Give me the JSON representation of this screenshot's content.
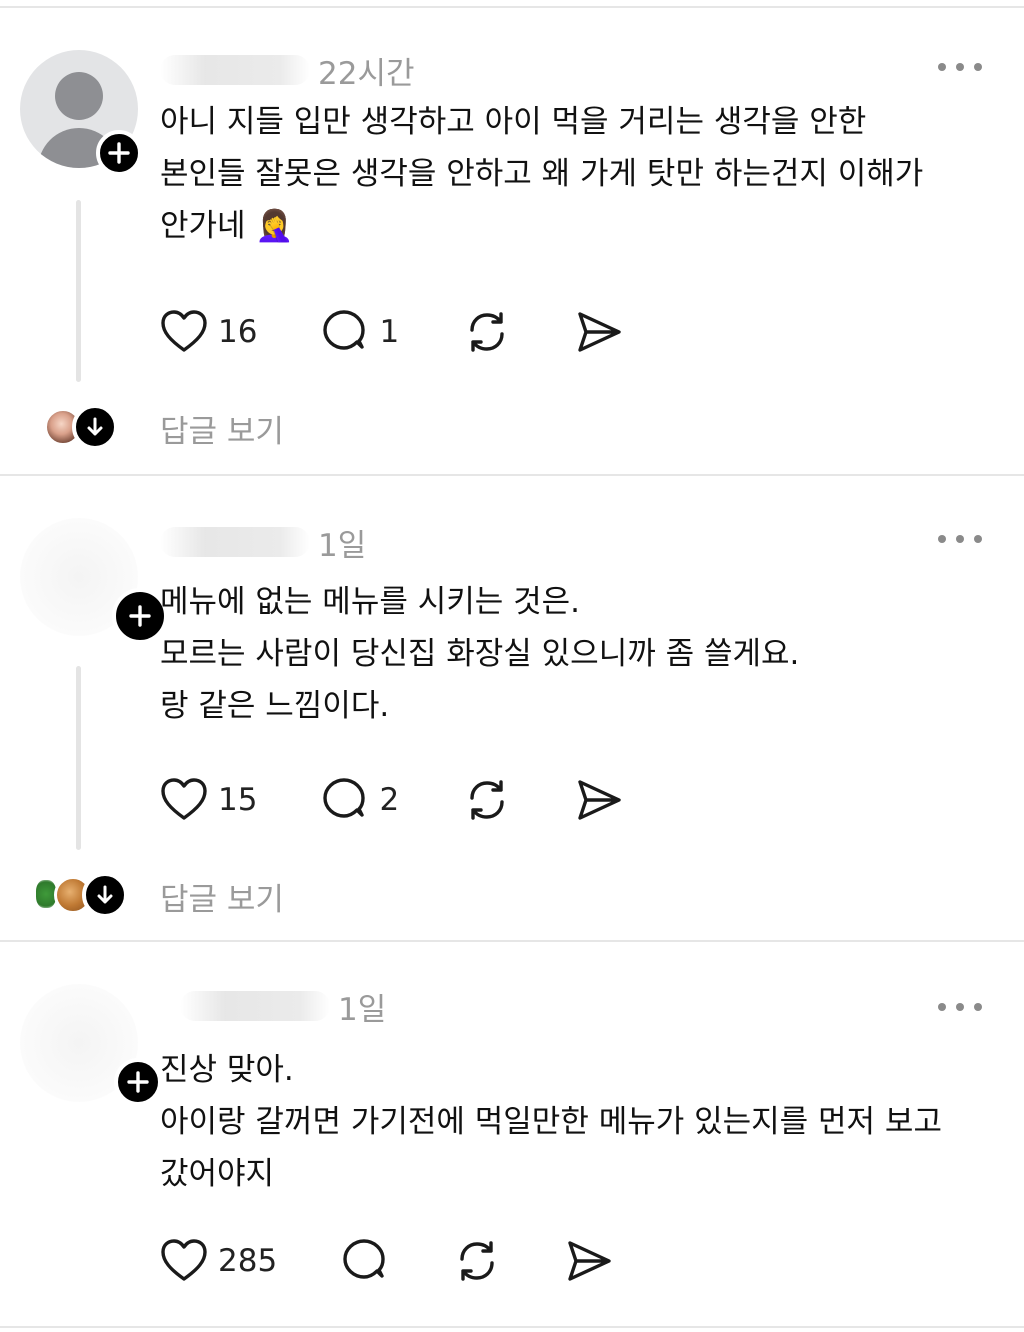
{
  "posts": [
    {
      "time": "22시간",
      "lines": [
        "아니 지들 입만 생각하고 아이 먹을 거리는 생각을 안한",
        "본인들 잘못은 생각을 안하고 왜 가게 탓만 하는건지 이해가",
        "안가네 🤦‍♀️"
      ],
      "likes": "16",
      "comments": "1",
      "view_replies": "답글 보기"
    },
    {
      "time": "1일",
      "lines": [
        "메뉴에 없는 메뉴를 시키는 것은.",
        "모르는 사람이 당신집 화장실 있으니까 좀 쓸게요.",
        "랑 같은 느낌이다."
      ],
      "likes": "15",
      "comments": "2",
      "view_replies": "답글 보기"
    },
    {
      "time": "1일",
      "lines": [
        "진상 맞아.",
        "아이랑 갈꺼면 가기전에 먹일만한 메뉴가 있는지를 먼저 보고",
        "갔어야지"
      ],
      "likes": "285"
    }
  ],
  "icons": {
    "like": "heart-icon",
    "comment": "comment-bubble-icon",
    "repost": "repost-icon",
    "share": "send-icon",
    "more": "more-horizontal-icon",
    "follow": "plus-icon",
    "expand": "arrow-down-icon"
  },
  "colors": {
    "badge": "#000000",
    "muted": "#9a9a9a",
    "divider": "#e6e6e6"
  }
}
